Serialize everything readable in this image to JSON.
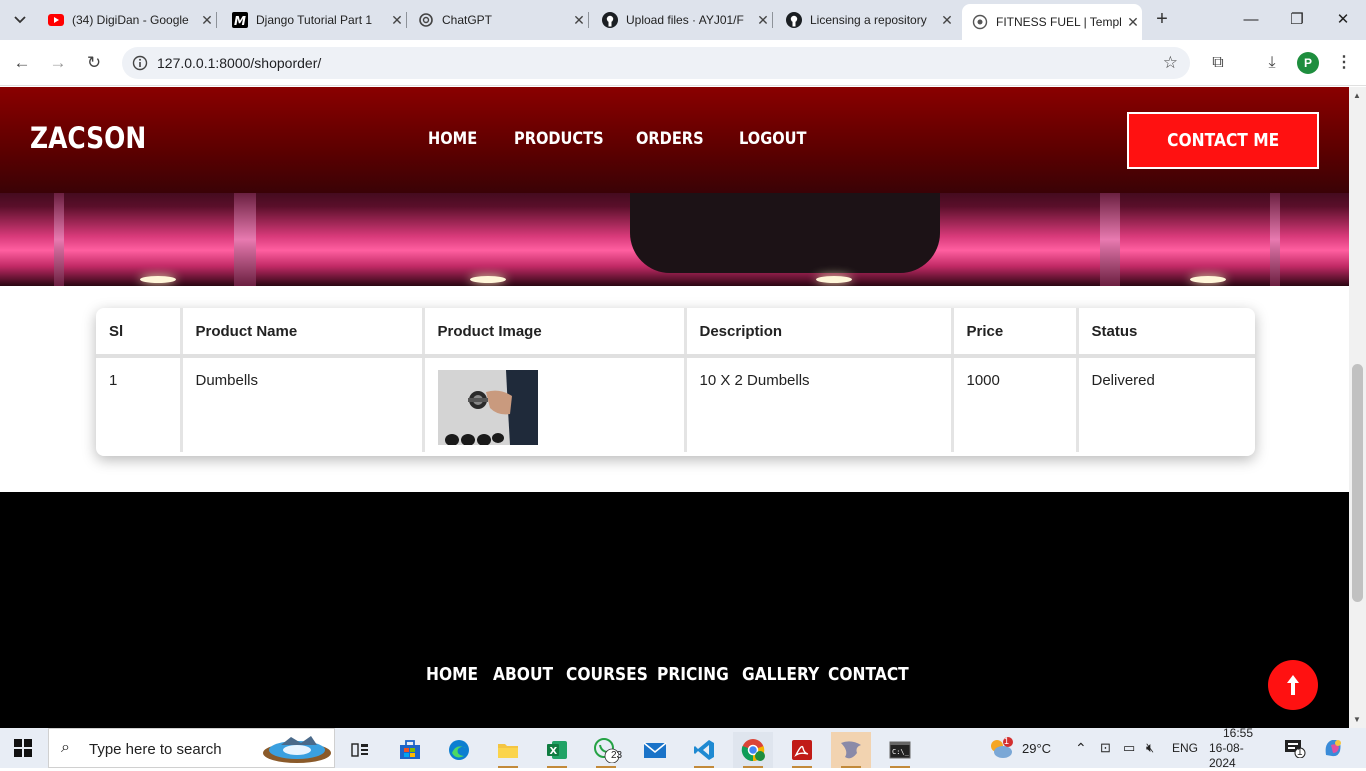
{
  "browser": {
    "tabs": [
      {
        "title": "(34) DigiDan - Google",
        "icon": "youtube-icon",
        "active": false
      },
      {
        "title": "Django Tutorial Part 1",
        "icon": "medium-icon",
        "active": false
      },
      {
        "title": "ChatGPT",
        "icon": "chatgpt-icon",
        "active": false
      },
      {
        "title": "Upload files · AYJ01/F",
        "icon": "github-icon",
        "active": false
      },
      {
        "title": "Licensing a repository",
        "icon": "github-icon",
        "active": false
      },
      {
        "title": "FITNESS FUEL | Templ",
        "icon": "globe-icon",
        "active": true
      }
    ],
    "url": "127.0.0.1:8000/shoporder/",
    "profile_initial": "P"
  },
  "site": {
    "logo": "ZACSON",
    "nav": [
      "HOME",
      "PRODUCTS",
      "ORDERS",
      "LOGOUT"
    ],
    "contact_button": "CONTACT ME"
  },
  "orders_table": {
    "headers": [
      "Sl",
      "Product Name",
      "Product Image",
      "Description",
      "Price",
      "Status"
    ],
    "rows": [
      {
        "sl": "1",
        "product_name": "Dumbells",
        "description": "10 X 2 Dumbells",
        "price": "1000",
        "status": "Delivered"
      }
    ]
  },
  "footer": {
    "nav": [
      "HOME",
      "ABOUT",
      "COURSES",
      "PRICING",
      "GALLERY",
      "CONTACT"
    ]
  },
  "taskbar": {
    "search_placeholder": "Type here to search",
    "whatsapp_badge": "23",
    "weather_temp": "29°C",
    "weather_badge": "1",
    "language": "ENG",
    "time": "16:55",
    "date": "16-08-2024",
    "notification_count": "1"
  },
  "colors": {
    "brand_red": "#ff1111",
    "header_red": "#8a0000"
  }
}
